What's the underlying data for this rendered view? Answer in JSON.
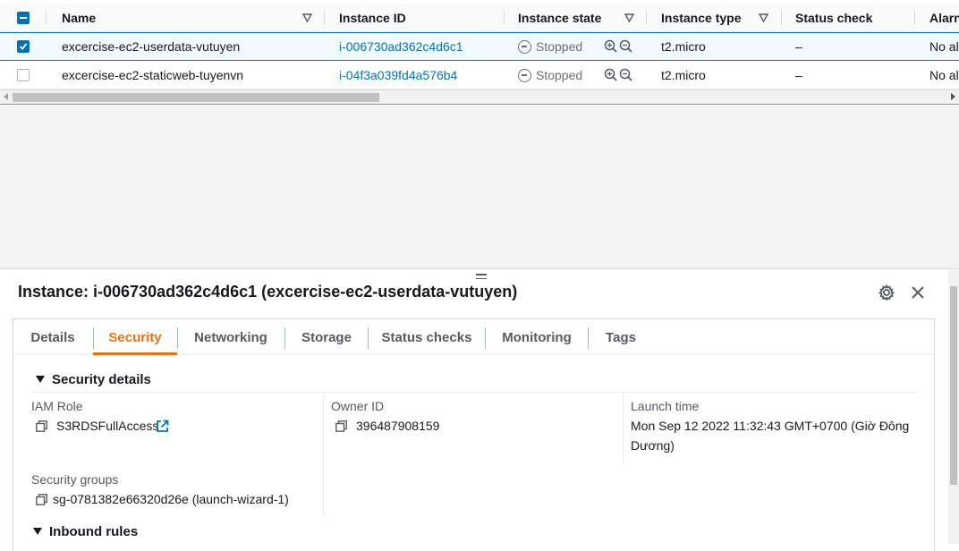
{
  "table": {
    "columns": {
      "name": "Name",
      "instance_id": "Instance ID",
      "instance_state": "Instance state",
      "instance_type": "Instance type",
      "status_check": "Status check",
      "alarm": "Alarn"
    },
    "rows": [
      {
        "selected": true,
        "name": "excercise-ec2-userdata-vutuyen",
        "instance_id": "i-006730ad362c4d6c1",
        "state": "Stopped",
        "type": "t2.micro",
        "status_check": "–",
        "alarm": "No al"
      },
      {
        "selected": false,
        "name": "excercise-ec2-staticweb-tuyenvn",
        "instance_id": "i-04f3a039fd4a576b4",
        "state": "Stopped",
        "type": "t2.micro",
        "status_check": "–",
        "alarm": "No al"
      }
    ]
  },
  "panel": {
    "title": "Instance: i-006730ad362c4d6c1 (excercise-ec2-userdata-vutuyen)",
    "tabs": [
      "Details",
      "Security",
      "Networking",
      "Storage",
      "Status checks",
      "Monitoring",
      "Tags"
    ],
    "active_tab": "Security",
    "security_details": {
      "heading": "Security details",
      "iam_role_label": "IAM Role",
      "iam_role_value": "S3RDSFullAccess",
      "owner_id_label": "Owner ID",
      "owner_id_value": "396487908159",
      "launch_time_label": "Launch time",
      "launch_time_line1": "Mon Sep 12 2022 11:32:43 GMT+0700 (Giờ Đông",
      "launch_time_line2": "Dương)",
      "security_groups_label": "Security groups",
      "security_groups_value": "sg-0781382e66320d26e (launch-wizard-1)"
    },
    "inbound_rules_heading": "Inbound rules"
  },
  "colors": {
    "link": "#0073bb",
    "active_tab": "#ec7211",
    "selected_row_bg": "#f1faff",
    "stopped_state": "#687078"
  }
}
